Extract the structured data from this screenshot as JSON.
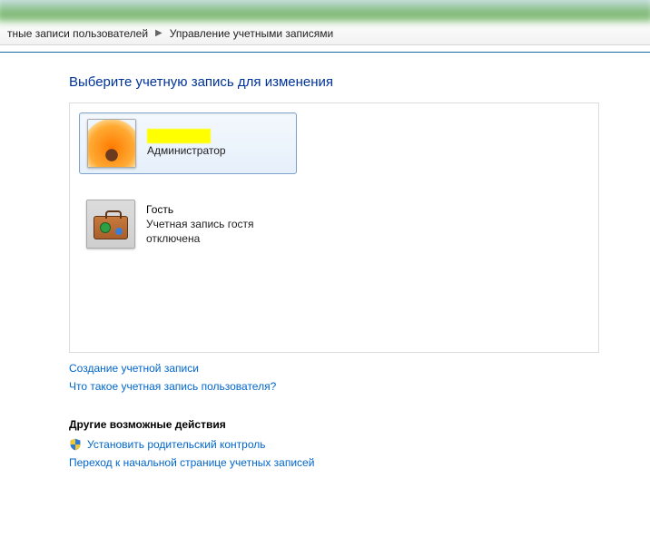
{
  "breadcrumb": {
    "crumb1": "тные записи пользователей",
    "crumb2": "Управление учетными записями"
  },
  "page": {
    "title": "Выберите учетную запись для изменения"
  },
  "accounts": [
    {
      "name": "",
      "role": "Администратор",
      "status": ""
    },
    {
      "name": "Гость",
      "role": "",
      "status": "Учетная запись гостя отключена"
    }
  ],
  "links": {
    "create_account": "Создание учетной записи",
    "what_is_account": "Что такое учетная запись пользователя?",
    "other_heading": "Другие возможные действия",
    "parental_control": "Установить родительский контроль",
    "goto_main": "Переход к начальной странице учетных записей"
  }
}
